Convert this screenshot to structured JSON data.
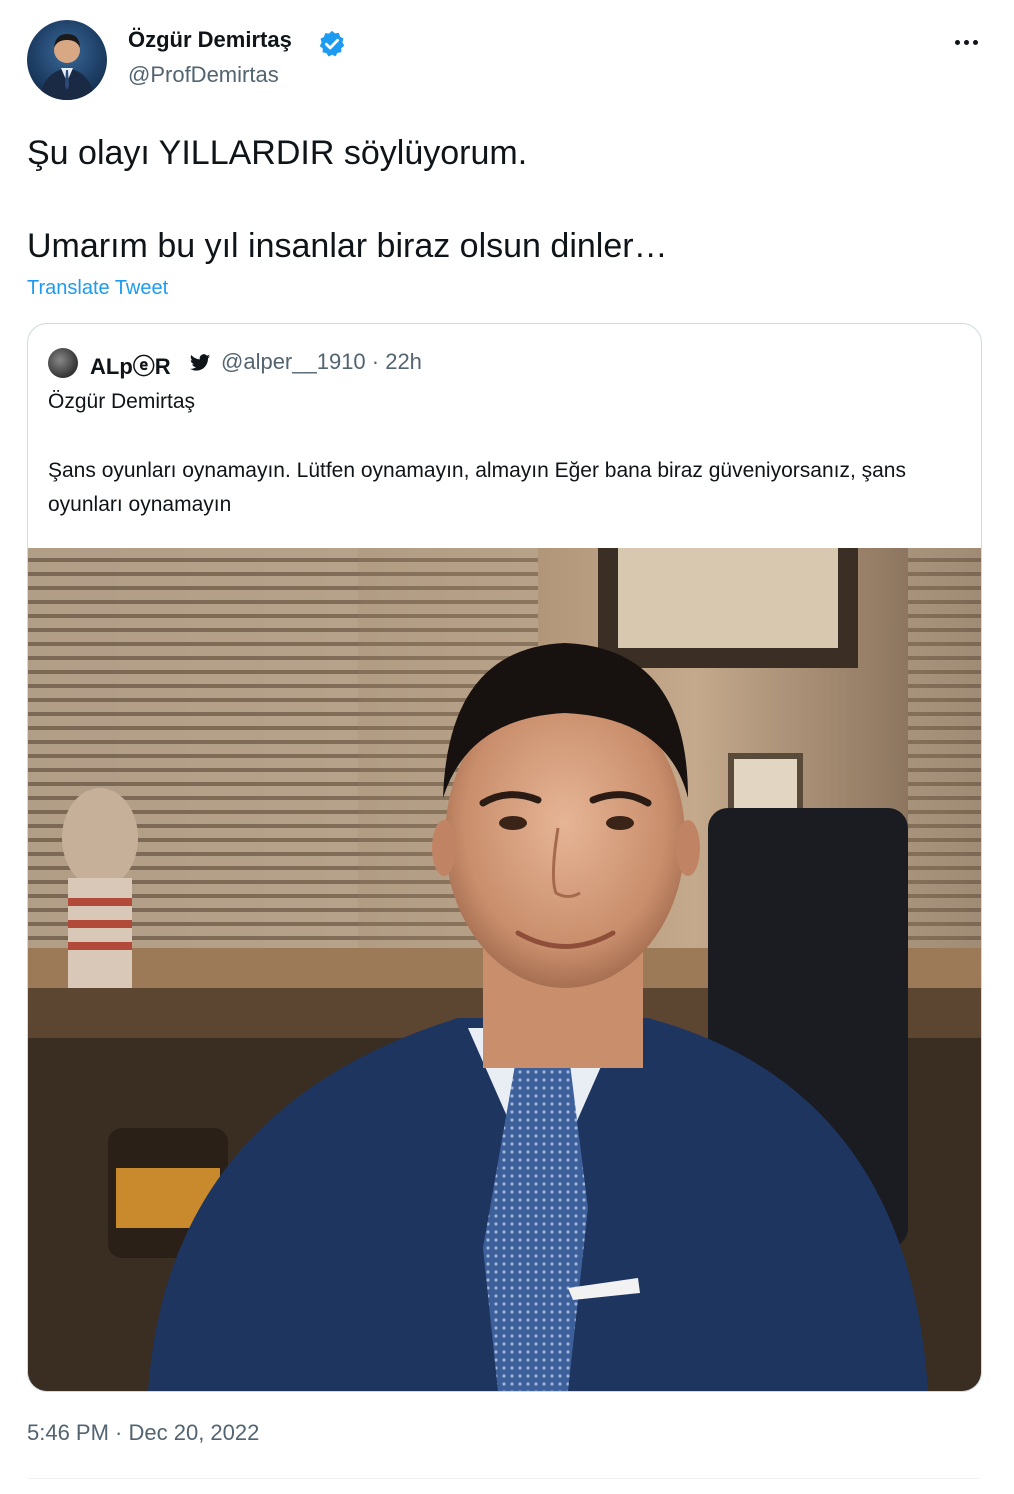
{
  "author": {
    "name": "Özgür Demirtaş",
    "handle": "@ProfDemirtas",
    "verified": true,
    "avatar_icon": "profile-photo"
  },
  "tweet": {
    "line1": "Şu olayı YILLARDIR söylüyorum.",
    "line2": "Umarım bu yıl insanlar biraz olsun dinler…",
    "translate_label": "Translate Tweet",
    "timestamp": "5:46 PM · Dec 20, 2022"
  },
  "quoted": {
    "name": "ALpⓔR",
    "handle_time": "@alper__1910 · 22h",
    "body_line1": "Özgür Demirtaş",
    "body_line2": "Şans oyunları oynamayın. Lütfen oynamayın, almayın Eğer bana biraz güveniyorsanız, şans oyunları oynamayın",
    "media_icon": "portrait-photo"
  },
  "colors": {
    "text": "#0f1419",
    "secondary": "#536471",
    "link": "#1d9bf0",
    "border": "#cfd9de"
  }
}
